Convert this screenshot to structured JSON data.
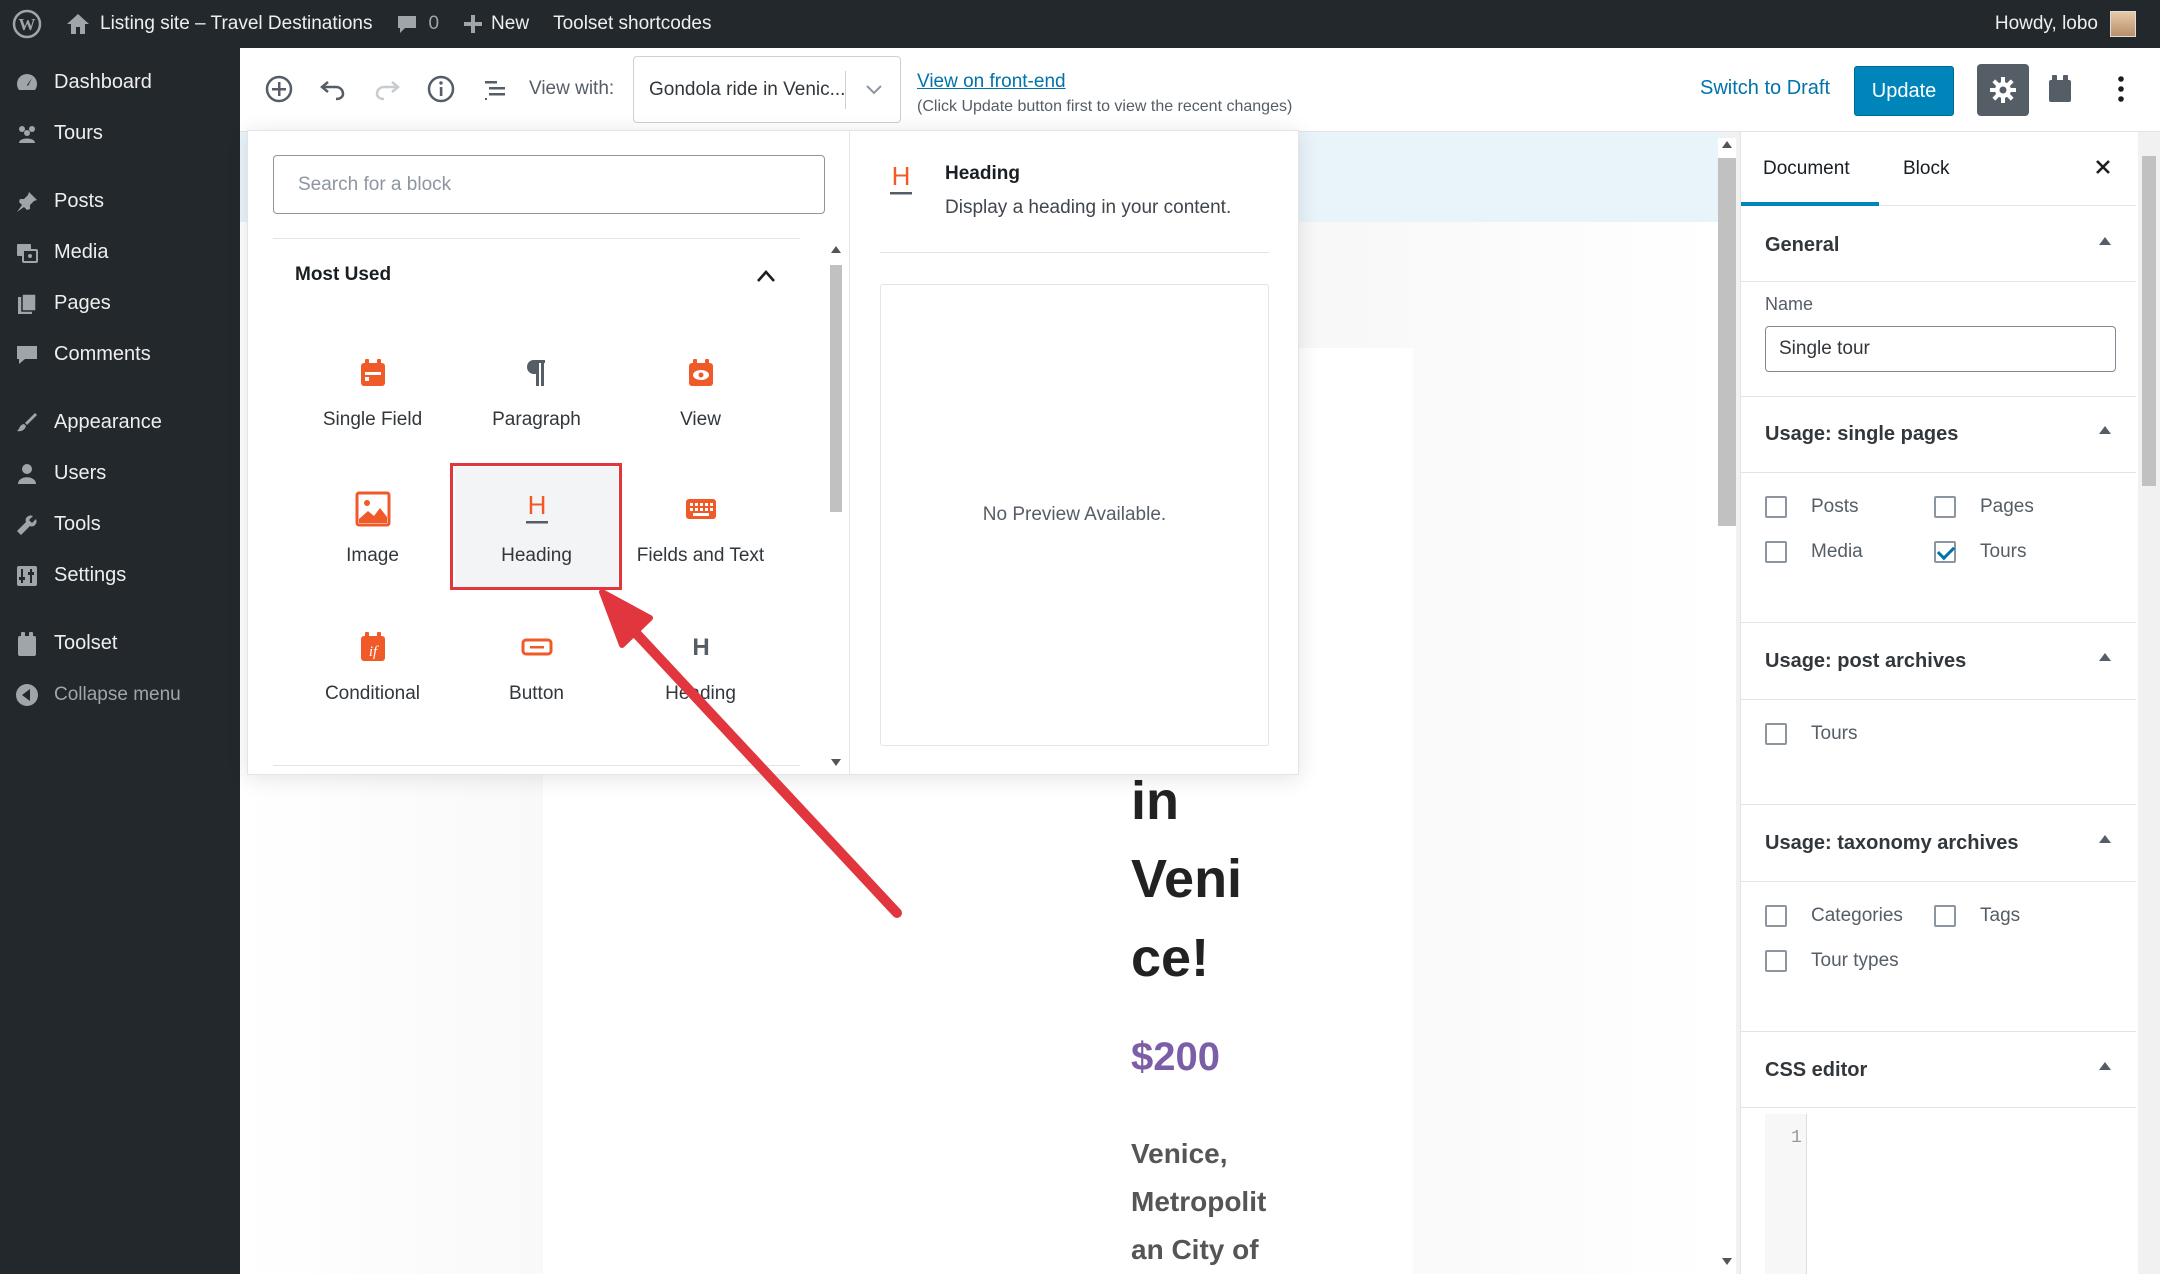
{
  "adminbar": {
    "site_name": "Listing site – Travel Destinations",
    "comments_count": "0",
    "new_label": "New",
    "toolset_shortcodes": "Toolset shortcodes",
    "howdy": "Howdy, lobo"
  },
  "menu": {
    "items": [
      {
        "label": "Dashboard",
        "icon": "dashboard-icon"
      },
      {
        "label": "Tours",
        "icon": "tours-icon"
      },
      {
        "label": "Posts",
        "icon": "pin-icon"
      },
      {
        "label": "Media",
        "icon": "media-icon"
      },
      {
        "label": "Pages",
        "icon": "pages-icon"
      },
      {
        "label": "Comments",
        "icon": "comments-icon"
      },
      {
        "label": "Appearance",
        "icon": "brush-icon"
      },
      {
        "label": "Users",
        "icon": "users-icon"
      },
      {
        "label": "Tools",
        "icon": "wrench-icon"
      },
      {
        "label": "Settings",
        "icon": "settings-icon"
      },
      {
        "label": "Toolset",
        "icon": "toolset-icon"
      },
      {
        "label": "Collapse menu",
        "icon": "collapse-icon"
      }
    ]
  },
  "header": {
    "view_with_label": "View with:",
    "view_with_value": "Gondola ride in Venic...",
    "frontend_link": "View on front-end",
    "frontend_note": "(Click Update button first to view the recent changes)",
    "switch_draft": "Switch to Draft",
    "update": "Update"
  },
  "inserter": {
    "search_placeholder": "Search for a block",
    "panel_title": "Most Used",
    "blocks": [
      {
        "label": "Single Field",
        "icon": "calendar-field-icon"
      },
      {
        "label": "Paragraph",
        "icon": "paragraph-icon"
      },
      {
        "label": "View",
        "icon": "view-eye-icon"
      },
      {
        "label": "Image",
        "icon": "image-icon"
      },
      {
        "label": "Heading",
        "icon": "heading-toolset-icon"
      },
      {
        "label": "Fields and Text",
        "icon": "keyboard-icon"
      },
      {
        "label": "Conditional",
        "icon": "conditional-icon"
      },
      {
        "label": "Button",
        "icon": "button-icon"
      },
      {
        "label": "Heading",
        "icon": "heading-core-icon"
      }
    ],
    "preview": {
      "title": "Heading",
      "description": "Display a heading in your content.",
      "no_preview": "No Preview Available."
    }
  },
  "canvas": {
    "title_lines": [
      "in",
      "Veni",
      "ce!"
    ],
    "price": "$200",
    "location_lines": [
      "Venice,",
      "Metropolit",
      "an City of"
    ]
  },
  "sidebar": {
    "tabs": [
      "Document",
      "Block"
    ],
    "general_title": "General",
    "name_label": "Name",
    "name_value": "Single tour",
    "usage_single_title": "Usage: single pages",
    "usage_single": [
      {
        "label": "Posts",
        "checked": false
      },
      {
        "label": "Pages",
        "checked": false
      },
      {
        "label": "Media",
        "checked": false
      },
      {
        "label": "Tours",
        "checked": true
      }
    ],
    "usage_archives_title": "Usage: post archives",
    "usage_archives": [
      {
        "label": "Tours",
        "checked": false
      }
    ],
    "usage_tax_title": "Usage: taxonomy archives",
    "usage_tax": [
      {
        "label": "Categories",
        "checked": false
      },
      {
        "label": "Tags",
        "checked": false
      },
      {
        "label": "Tour types",
        "checked": false
      }
    ],
    "css_title": "CSS editor",
    "css_line_number": "1"
  },
  "colors": {
    "admin_dark": "#23282d",
    "accent_blue": "#0085ba",
    "toolset_orange": "#f05a28",
    "annotation_red": "#e2363f",
    "price_purple": "#7b5ea7"
  }
}
